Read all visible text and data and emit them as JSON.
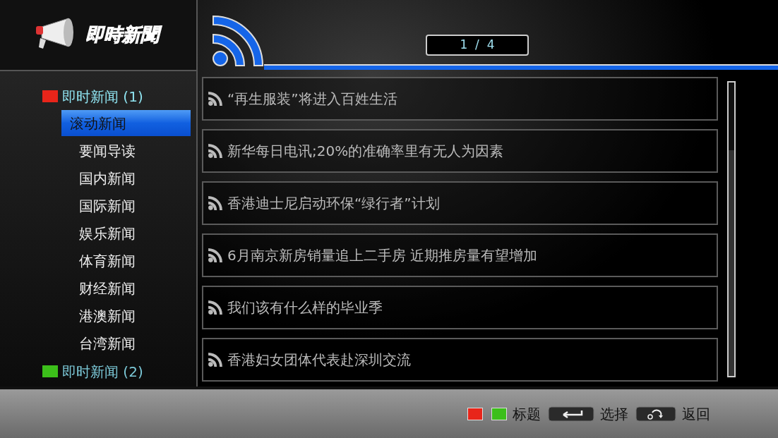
{
  "logo": {
    "text": "即時新聞"
  },
  "sidebar": {
    "groups": [
      {
        "label": "即时新闻 (1)",
        "color": "#e8251a",
        "expanded": true,
        "children": [
          {
            "label": "滚动新闻",
            "selected": true
          },
          {
            "label": "要闻导读",
            "selected": false
          },
          {
            "label": "国内新闻",
            "selected": false
          },
          {
            "label": "国际新闻",
            "selected": false
          },
          {
            "label": "娱乐新闻",
            "selected": false
          },
          {
            "label": "体育新闻",
            "selected": false
          },
          {
            "label": "财经新闻",
            "selected": false
          },
          {
            "label": "港澳新闻",
            "selected": false
          },
          {
            "label": "台湾新闻",
            "selected": false
          }
        ]
      },
      {
        "label": "即时新闻 (2)",
        "color": "#3cbf1a",
        "expanded": false
      }
    ]
  },
  "pager": {
    "text": "1  /  4"
  },
  "news": [
    {
      "title": "“再生服装”将进入百姓生活"
    },
    {
      "title": "新华每日电讯;20%的准确率里有无人为因素"
    },
    {
      "title": "香港迪士尼启动环保“绿行者”计划"
    },
    {
      "title": "6月南京新房销量追上二手房 近期推房量有望增加"
    },
    {
      "title": "我们该有什么样的毕业季"
    },
    {
      "title": "香港妇女团体代表赴深圳交流"
    }
  ],
  "footer": {
    "hints": [
      {
        "kind": "color_keys",
        "keys": [
          {
            "color": "#e8251a"
          },
          {
            "color": "#3cbf1a"
          }
        ],
        "label": "标题"
      },
      {
        "kind": "enter_key",
        "label": "选择"
      },
      {
        "kind": "back_key",
        "label": "返回"
      }
    ]
  }
}
